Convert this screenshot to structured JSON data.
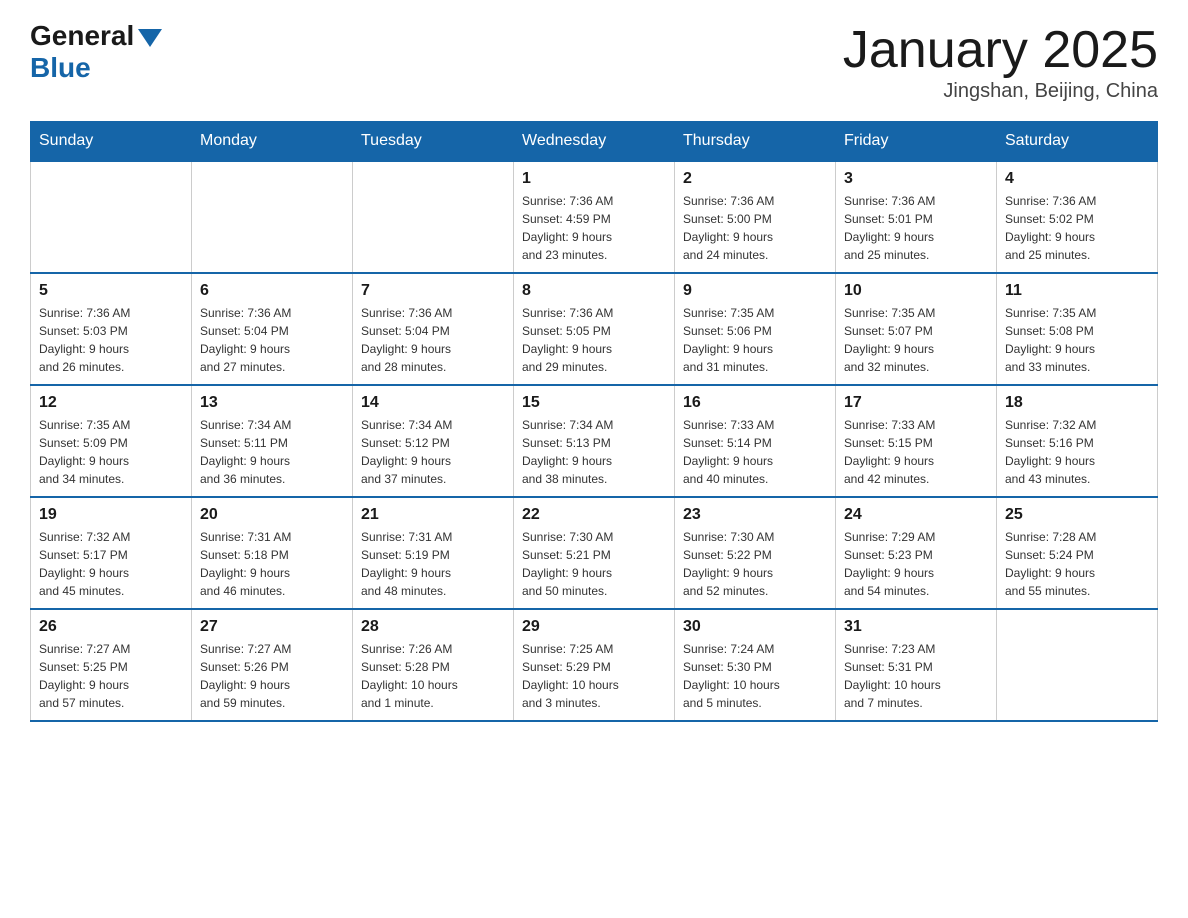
{
  "header": {
    "logo_general": "General",
    "logo_blue": "Blue",
    "month_year": "January 2025",
    "location": "Jingshan, Beijing, China"
  },
  "weekdays": [
    "Sunday",
    "Monday",
    "Tuesday",
    "Wednesday",
    "Thursday",
    "Friday",
    "Saturday"
  ],
  "weeks": [
    [
      {
        "day": "",
        "info": ""
      },
      {
        "day": "",
        "info": ""
      },
      {
        "day": "",
        "info": ""
      },
      {
        "day": "1",
        "info": "Sunrise: 7:36 AM\nSunset: 4:59 PM\nDaylight: 9 hours\nand 23 minutes."
      },
      {
        "day": "2",
        "info": "Sunrise: 7:36 AM\nSunset: 5:00 PM\nDaylight: 9 hours\nand 24 minutes."
      },
      {
        "day": "3",
        "info": "Sunrise: 7:36 AM\nSunset: 5:01 PM\nDaylight: 9 hours\nand 25 minutes."
      },
      {
        "day": "4",
        "info": "Sunrise: 7:36 AM\nSunset: 5:02 PM\nDaylight: 9 hours\nand 25 minutes."
      }
    ],
    [
      {
        "day": "5",
        "info": "Sunrise: 7:36 AM\nSunset: 5:03 PM\nDaylight: 9 hours\nand 26 minutes."
      },
      {
        "day": "6",
        "info": "Sunrise: 7:36 AM\nSunset: 5:04 PM\nDaylight: 9 hours\nand 27 minutes."
      },
      {
        "day": "7",
        "info": "Sunrise: 7:36 AM\nSunset: 5:04 PM\nDaylight: 9 hours\nand 28 minutes."
      },
      {
        "day": "8",
        "info": "Sunrise: 7:36 AM\nSunset: 5:05 PM\nDaylight: 9 hours\nand 29 minutes."
      },
      {
        "day": "9",
        "info": "Sunrise: 7:35 AM\nSunset: 5:06 PM\nDaylight: 9 hours\nand 31 minutes."
      },
      {
        "day": "10",
        "info": "Sunrise: 7:35 AM\nSunset: 5:07 PM\nDaylight: 9 hours\nand 32 minutes."
      },
      {
        "day": "11",
        "info": "Sunrise: 7:35 AM\nSunset: 5:08 PM\nDaylight: 9 hours\nand 33 minutes."
      }
    ],
    [
      {
        "day": "12",
        "info": "Sunrise: 7:35 AM\nSunset: 5:09 PM\nDaylight: 9 hours\nand 34 minutes."
      },
      {
        "day": "13",
        "info": "Sunrise: 7:34 AM\nSunset: 5:11 PM\nDaylight: 9 hours\nand 36 minutes."
      },
      {
        "day": "14",
        "info": "Sunrise: 7:34 AM\nSunset: 5:12 PM\nDaylight: 9 hours\nand 37 minutes."
      },
      {
        "day": "15",
        "info": "Sunrise: 7:34 AM\nSunset: 5:13 PM\nDaylight: 9 hours\nand 38 minutes."
      },
      {
        "day": "16",
        "info": "Sunrise: 7:33 AM\nSunset: 5:14 PM\nDaylight: 9 hours\nand 40 minutes."
      },
      {
        "day": "17",
        "info": "Sunrise: 7:33 AM\nSunset: 5:15 PM\nDaylight: 9 hours\nand 42 minutes."
      },
      {
        "day": "18",
        "info": "Sunrise: 7:32 AM\nSunset: 5:16 PM\nDaylight: 9 hours\nand 43 minutes."
      }
    ],
    [
      {
        "day": "19",
        "info": "Sunrise: 7:32 AM\nSunset: 5:17 PM\nDaylight: 9 hours\nand 45 minutes."
      },
      {
        "day": "20",
        "info": "Sunrise: 7:31 AM\nSunset: 5:18 PM\nDaylight: 9 hours\nand 46 minutes."
      },
      {
        "day": "21",
        "info": "Sunrise: 7:31 AM\nSunset: 5:19 PM\nDaylight: 9 hours\nand 48 minutes."
      },
      {
        "day": "22",
        "info": "Sunrise: 7:30 AM\nSunset: 5:21 PM\nDaylight: 9 hours\nand 50 minutes."
      },
      {
        "day": "23",
        "info": "Sunrise: 7:30 AM\nSunset: 5:22 PM\nDaylight: 9 hours\nand 52 minutes."
      },
      {
        "day": "24",
        "info": "Sunrise: 7:29 AM\nSunset: 5:23 PM\nDaylight: 9 hours\nand 54 minutes."
      },
      {
        "day": "25",
        "info": "Sunrise: 7:28 AM\nSunset: 5:24 PM\nDaylight: 9 hours\nand 55 minutes."
      }
    ],
    [
      {
        "day": "26",
        "info": "Sunrise: 7:27 AM\nSunset: 5:25 PM\nDaylight: 9 hours\nand 57 minutes."
      },
      {
        "day": "27",
        "info": "Sunrise: 7:27 AM\nSunset: 5:26 PM\nDaylight: 9 hours\nand 59 minutes."
      },
      {
        "day": "28",
        "info": "Sunrise: 7:26 AM\nSunset: 5:28 PM\nDaylight: 10 hours\nand 1 minute."
      },
      {
        "day": "29",
        "info": "Sunrise: 7:25 AM\nSunset: 5:29 PM\nDaylight: 10 hours\nand 3 minutes."
      },
      {
        "day": "30",
        "info": "Sunrise: 7:24 AM\nSunset: 5:30 PM\nDaylight: 10 hours\nand 5 minutes."
      },
      {
        "day": "31",
        "info": "Sunrise: 7:23 AM\nSunset: 5:31 PM\nDaylight: 10 hours\nand 7 minutes."
      },
      {
        "day": "",
        "info": ""
      }
    ]
  ]
}
